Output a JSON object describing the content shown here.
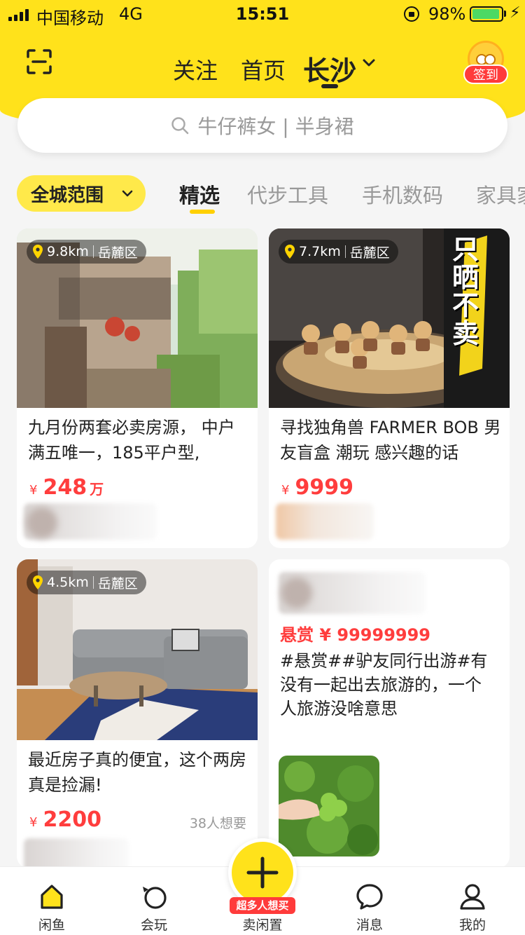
{
  "status": {
    "carrier": "中国移动",
    "network": "4G",
    "time": "15:51",
    "battery": "98%"
  },
  "header": {
    "tabs": {
      "follow": "关注",
      "home": "首页",
      "city": "长沙"
    },
    "checkin": "签到"
  },
  "search": {
    "placeholder": "牛仔裤女 | 半身裙"
  },
  "filter": {
    "scope": "全城范围",
    "categories": [
      "精选",
      "代步工具",
      "手机数码",
      "家具家"
    ]
  },
  "cards": [
    {
      "distance": "9.8km",
      "area": "岳麓区",
      "title": "九月份两套必卖房源， 中户满五唯一，185平户型,",
      "price": "248",
      "unit": "万"
    },
    {
      "distance": "7.7km",
      "area": "岳麓区",
      "title": "寻找独角兽 FARMER BOB 男友盲盒 潮玩 感兴趣的话",
      "price": "9999",
      "overlay": "只晒不卖"
    },
    {
      "distance": "4.5km",
      "area": "岳麓区",
      "title": "最近房子真的便宜，这个两房真是捡漏!",
      "price": "2200",
      "want": "38人想要"
    },
    {
      "bounty": "悬赏 ¥ 99999999",
      "text": "#悬赏##驴友同行出游#有没有一起出去旅游的，一个人旅游没啥意思"
    }
  ],
  "currency": "¥",
  "tabbar": {
    "home": "闲鱼",
    "play": "会玩",
    "sell": "卖闲置",
    "sell_badge": "超多人想买",
    "messages": "消息",
    "mine": "我的"
  },
  "colors": {
    "brand_yellow": "#ffe21b",
    "price_red": "#ff3d3d"
  }
}
